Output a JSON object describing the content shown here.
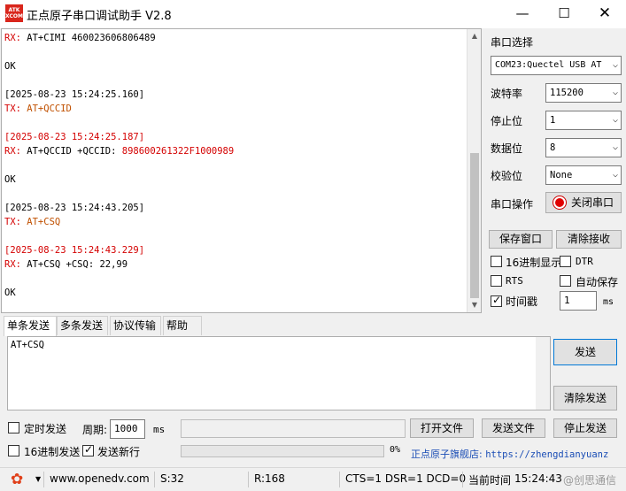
{
  "window": {
    "title": "正点原子串口调试助手 V2.8",
    "logo_line1": "ATK",
    "logo_line2": "XCOM"
  },
  "receive": {
    "lines": [
      {
        "prefix": "RX:",
        "text": " AT+CIMI 460023606806489",
        "color": "black"
      },
      {
        "prefix": "",
        "text": "",
        "color": "black"
      },
      {
        "prefix": "",
        "text": "OK",
        "color": "black"
      },
      {
        "prefix": "",
        "text": "",
        "color": "black"
      },
      {
        "prefix": "",
        "text": "[2025-08-23 15:24:25.160]",
        "color": "black"
      },
      {
        "prefix": "TX:",
        "text": " AT+QCCID",
        "color": "orange"
      },
      {
        "prefix": "",
        "text": "",
        "color": "black"
      },
      {
        "prefix": "",
        "text": "[2025-08-23 15:24:25.187]",
        "color": "red"
      },
      {
        "prefix": "RX:",
        "text": " AT+QCCID +QCCID: 898600261322F1000989",
        "color": "mixed"
      },
      {
        "prefix": "",
        "text": "",
        "color": "black"
      },
      {
        "prefix": "",
        "text": "OK",
        "color": "black"
      },
      {
        "prefix": "",
        "text": "",
        "color": "black"
      },
      {
        "prefix": "",
        "text": "[2025-08-23 15:24:43.205]",
        "color": "black"
      },
      {
        "prefix": "TX:",
        "text": " AT+CSQ",
        "color": "orange"
      },
      {
        "prefix": "",
        "text": "",
        "color": "black"
      },
      {
        "prefix": "",
        "text": "[2025-08-23 15:24:43.229]",
        "color": "red"
      },
      {
        "prefix": "RX:",
        "text": " AT+CSQ +CSQ: 22,99",
        "color": "black"
      },
      {
        "prefix": "",
        "text": "",
        "color": "black"
      },
      {
        "prefix": "",
        "text": "OK",
        "color": "black"
      }
    ],
    "qccid_cmd": " AT+QCCID +QCCID: ",
    "qccid_value": "898600261322F1000989"
  },
  "settings": {
    "port_select_label": "串口选择",
    "port_value": "COM23:Quectel USB AT",
    "baud_label": "波特率",
    "baud_value": "115200",
    "stop_label": "停止位",
    "stop_value": "1",
    "data_label": "数据位",
    "data_value": "8",
    "parity_label": "校验位",
    "parity_value": "None",
    "port_op_label": "串口操作",
    "close_port_label": "关闭串口",
    "save_window_label": "保存窗口",
    "clear_receive_label": "清除接收",
    "hex_display_label": "16进制显示",
    "dtr_label": "DTR",
    "rts_label": "RTS",
    "auto_save_label": "自动保存",
    "timestamp_label": "时间戳",
    "timestamp_value": "1",
    "timestamp_unit": "ms",
    "hex_display_checked": false,
    "dtr_checked": false,
    "rts_checked": false,
    "auto_save_checked": false,
    "timestamp_checked": true
  },
  "tabs": [
    "单条发送",
    "多条发送",
    "协议传输",
    "帮助"
  ],
  "send": {
    "text": "AT+CSQ",
    "send_label": "发送",
    "clear_send_label": "清除发送",
    "timed_send_label": "定时发送",
    "period_label": "周期:",
    "period_value": "1000",
    "period_unit": "ms",
    "open_file_label": "打开文件",
    "send_file_label": "发送文件",
    "stop_send_label": "停止发送",
    "hex_send_label": "16进制发送",
    "send_newline_label": "发送新行",
    "progress_text": "0%",
    "progress_value": 0,
    "store_label": "正点原子旗舰店:",
    "store_url": "https://zhengdianyuanz",
    "timed_send_checked": false,
    "hex_send_checked": false,
    "send_newline_checked": true
  },
  "status": {
    "website": "www.openedv.com",
    "sent": "S:32",
    "received": "R:168",
    "signals": "CTS=1 DSR=1 DCD=0",
    "current_time_label": "当前时间",
    "current_time": "15:24:43",
    "watermark": "@创思通信"
  },
  "icons": {
    "gear": "gear-icon",
    "dropdown": "chevron-down-icon",
    "record": "record-icon"
  },
  "colors": {
    "red_text": "#d40000",
    "tx_text": "#c05000",
    "link": "#1a4db5",
    "gear": "#e0401a"
  }
}
